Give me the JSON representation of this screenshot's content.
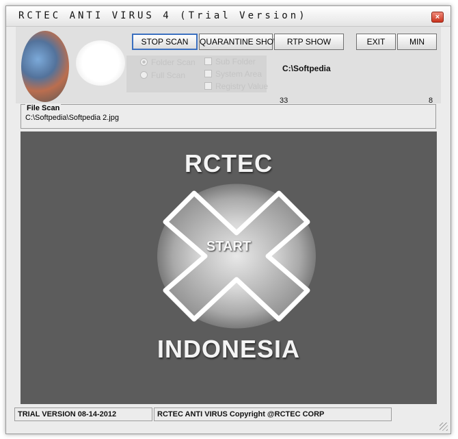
{
  "window": {
    "title": "RCTEC ANTI VIRUS 4 (Trial Version)",
    "close_label": "×"
  },
  "toolbar": {
    "stop_scan_label": "STOP SCAN",
    "quarantine_show_label": "QUARANTINE SHOW",
    "rtp_show_label": "RTP SHOW",
    "exit_label": "EXIT",
    "min_label": "MIN"
  },
  "scan_options": {
    "folder_scan": "Folder Scan",
    "full_scan": "Full Scan",
    "sub_folder": "Sub Folder",
    "system_area": "System Area",
    "registry_value": "Registry Value",
    "selected_mode": "Folder Scan"
  },
  "scan_target": {
    "path": "C:\\Softpedia",
    "count_left": "33",
    "count_right": "8"
  },
  "file_scan": {
    "label": "File Scan",
    "current_file": "C:\\Softpedia\\Softpedia 2.jpg"
  },
  "stage": {
    "brand_top": "RCTEC",
    "start_label": "START",
    "brand_bottom": "INDONESIA"
  },
  "status": {
    "left": "TRIAL VERSION 08-14-2012",
    "right": "RCTEC ANTI VIRUS Copyright @RCTEC CORP"
  },
  "icons": {
    "logo": "globe-logo-icon",
    "close": "close-icon",
    "grip": "resize-grip-icon",
    "start": "start-cross-icon"
  }
}
